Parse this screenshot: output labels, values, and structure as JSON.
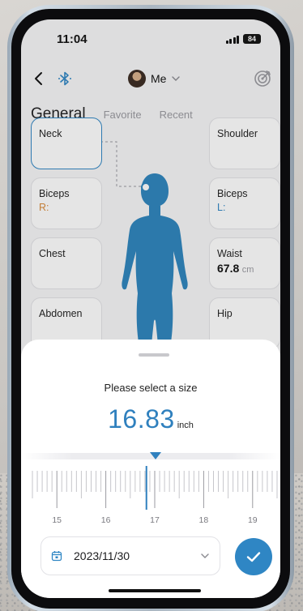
{
  "status_bar": {
    "time": "11:04",
    "battery": "84"
  },
  "nav": {
    "profile_name": "Me"
  },
  "tabs": {
    "active": "General",
    "items": [
      "Favorite",
      "Recent"
    ]
  },
  "cards_left": [
    {
      "label": "Neck",
      "value": ""
    },
    {
      "label": "Biceps",
      "value": "R:"
    },
    {
      "label": "Chest",
      "value": ""
    },
    {
      "label": "Abdomen",
      "value": ""
    }
  ],
  "cards_right": [
    {
      "label": "Shoulder",
      "value": ""
    },
    {
      "label": "Biceps",
      "value": "L:"
    },
    {
      "label": "Waist",
      "value": "67.8",
      "unit": "cm"
    },
    {
      "label": "Hip",
      "value": ""
    }
  ],
  "sheet": {
    "title": "Please select a size",
    "value": "16.83",
    "unit": "inch",
    "ruler_min": 14.5,
    "ruler_max": 19.5,
    "ruler_step": 0.1,
    "ruler_labels": [
      "15",
      "16",
      "17",
      "18",
      "19"
    ],
    "date": "2023/11/30"
  },
  "colors": {
    "accent": "#2f86c4",
    "figure": "#2d84bd",
    "right_side": "#2f86c4",
    "left_side": "#d98a3a"
  }
}
